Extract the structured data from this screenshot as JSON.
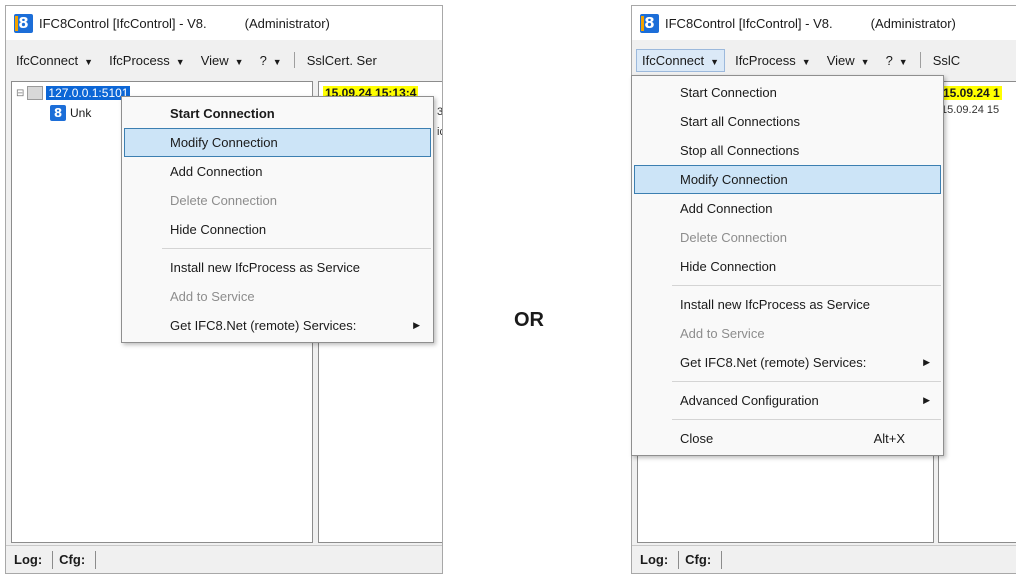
{
  "windowA": {
    "title": "IFC8Control [IfcControl] - V8.",
    "admin": "(Administrator)",
    "logo": "8",
    "menu": {
      "connect": "IfcConnect",
      "process": "IfcProcess",
      "view": "View",
      "help": "?",
      "sslcert": "SslCert. Ser"
    },
    "tree": {
      "root": "127.0.0.1:5101",
      "child": "Unk",
      "child_logo": "8"
    },
    "right_pane": {
      "date": "15.09.24 15:13:4",
      "frag1": "3",
      "frag2": "ic"
    },
    "status": {
      "log": "Log:",
      "cfg": "Cfg:"
    },
    "context_menu": {
      "start": "Start Connection",
      "modify": "Modify Connection",
      "add": "Add Connection",
      "delete": "Delete Connection",
      "hide": "Hide Connection",
      "install": "Install new IfcProcess as Service",
      "add_service": "Add to Service",
      "get_services": "Get IFC8.Net (remote) Services:"
    }
  },
  "separator_text": "OR",
  "windowB": {
    "title": "IFC8Control [IfcControl] - V8.",
    "admin": "(Administrator)",
    "logo": "8",
    "menu": {
      "connect": "IfcConnect",
      "process": "IfcProcess",
      "view": "View",
      "help": "?",
      "sslcert": "SslC"
    },
    "right_pane": {
      "date": "15.09.24 1",
      "date2": "15.09.24 15"
    },
    "status": {
      "log": "Log:",
      "cfg": "Cfg:"
    },
    "dropdown": {
      "start": "Start Connection",
      "start_all": "Start all Connections",
      "stop_all": "Stop all Connections",
      "modify": "Modify Connection",
      "add": "Add Connection",
      "delete": "Delete Connection",
      "hide": "Hide Connection",
      "install": "Install new IfcProcess as Service",
      "add_service": "Add to Service",
      "get_services": "Get IFC8.Net (remote) Services:",
      "advanced": "Advanced Configuration",
      "close": "Close",
      "close_shortcut": "Alt+X"
    }
  },
  "colors": {
    "selection_blue": "#0c66d6",
    "menu_highlight": "#cce4f7",
    "highlight_border": "#3c7fb1",
    "date_highlight": "#ffff00",
    "logo_blue": "#1c6ed8"
  },
  "icons": {
    "logo": "ifc8-logo-icon",
    "submenu_arrow": "triangle-right-icon",
    "menu_caret": "caret-down-icon"
  }
}
